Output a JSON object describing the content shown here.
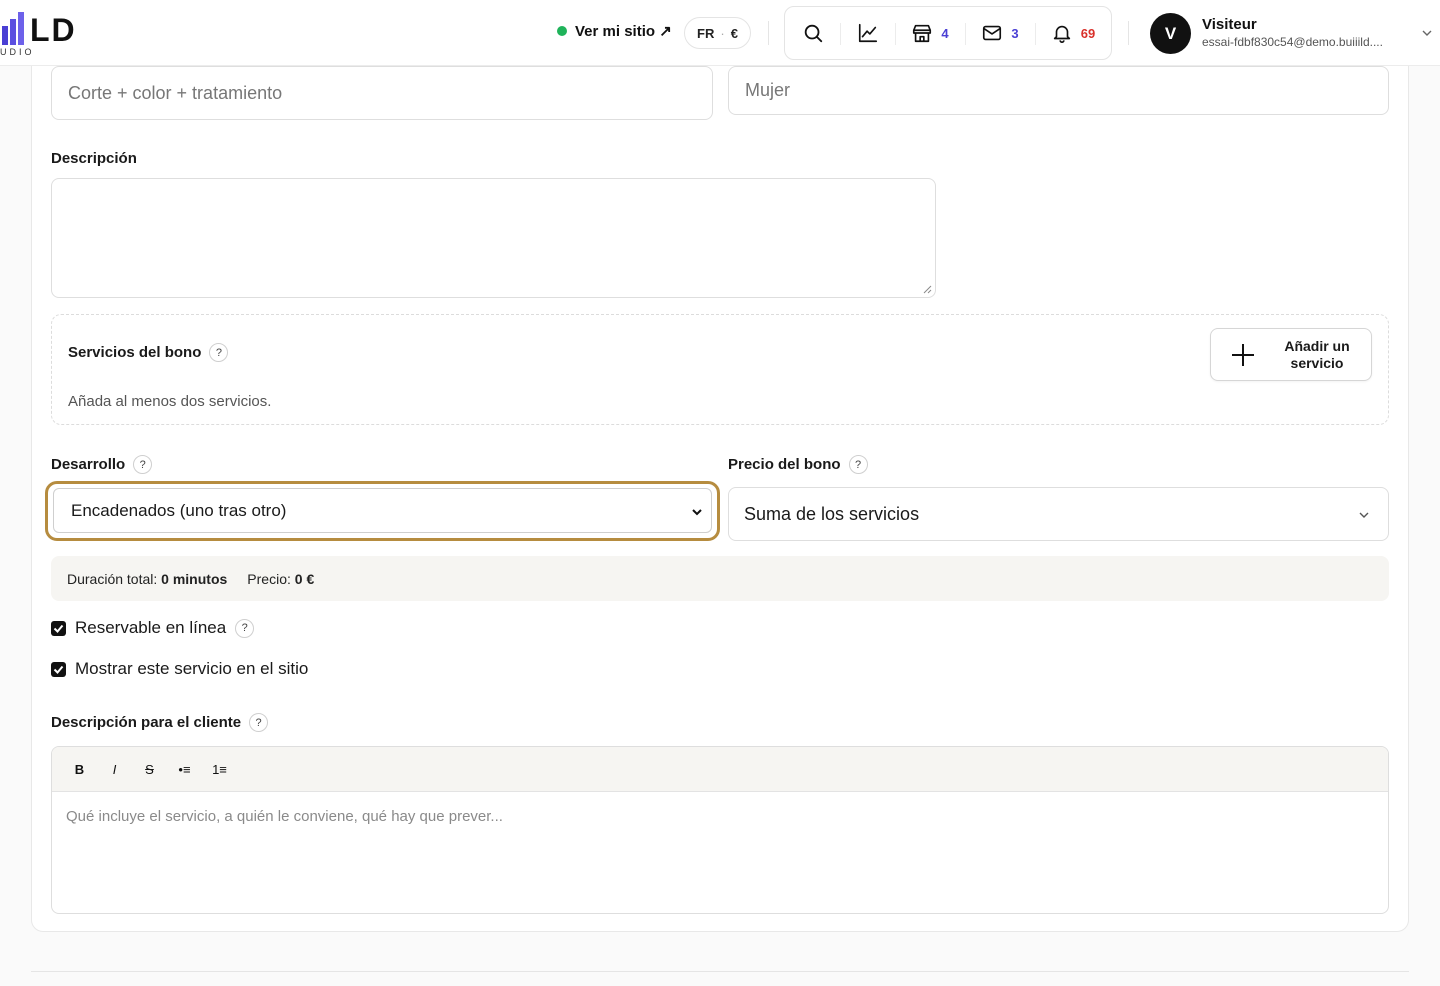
{
  "header": {
    "logo_letters": "LD",
    "logo_sub": "UDIO",
    "visit_site": "Ver mi sitio ↗",
    "lang": "FR",
    "currency": "€",
    "tools": [
      {
        "icon": "search-icon",
        "count": ""
      },
      {
        "icon": "chart-icon",
        "count": ""
      },
      {
        "icon": "store-icon",
        "count": "4"
      },
      {
        "icon": "mail-icon",
        "count": "3"
      },
      {
        "icon": "bell-icon",
        "count": "69"
      }
    ],
    "user": {
      "initial": "V",
      "name": "Visiteur",
      "email": "essai-fdbf830c54@demo.buiiild...."
    }
  },
  "form": {
    "name_value": "Corte + color + tratamiento",
    "category_value": "Mujer",
    "description_label": "Descripción",
    "description_value": "",
    "bono": {
      "title": "Servicios del bono",
      "hint": "Añada al menos dos servicios.",
      "add_button": "Añadir un servicio"
    },
    "desarrollo": {
      "label": "Desarrollo",
      "selected": "Encadenados (uno tras otro)"
    },
    "precio": {
      "label": "Precio del bono",
      "selected": "Suma de los servicios"
    },
    "summary": {
      "duration_label": "Duración total:",
      "duration_value": "0 minutos",
      "price_label": "Precio:",
      "price_value": "0 €"
    },
    "checkboxes": {
      "reservable": "Reservable en línea",
      "show_site": "Mostrar este servicio en el sitio"
    },
    "client_description": {
      "label": "Descripción para el cliente",
      "toolbar": {
        "bold": "B",
        "italic": "I",
        "strike": "S",
        "bullets": "•≡",
        "numbers": "1≡"
      },
      "placeholder": "Qué incluye el servicio, a quién le conviene, qué hay que prever..."
    }
  },
  "colors": {
    "focus_ring": "#b68c3f",
    "online_dot": "#1fb35a",
    "count_blue": "#4a3fd4",
    "count_red": "#d9312b"
  }
}
